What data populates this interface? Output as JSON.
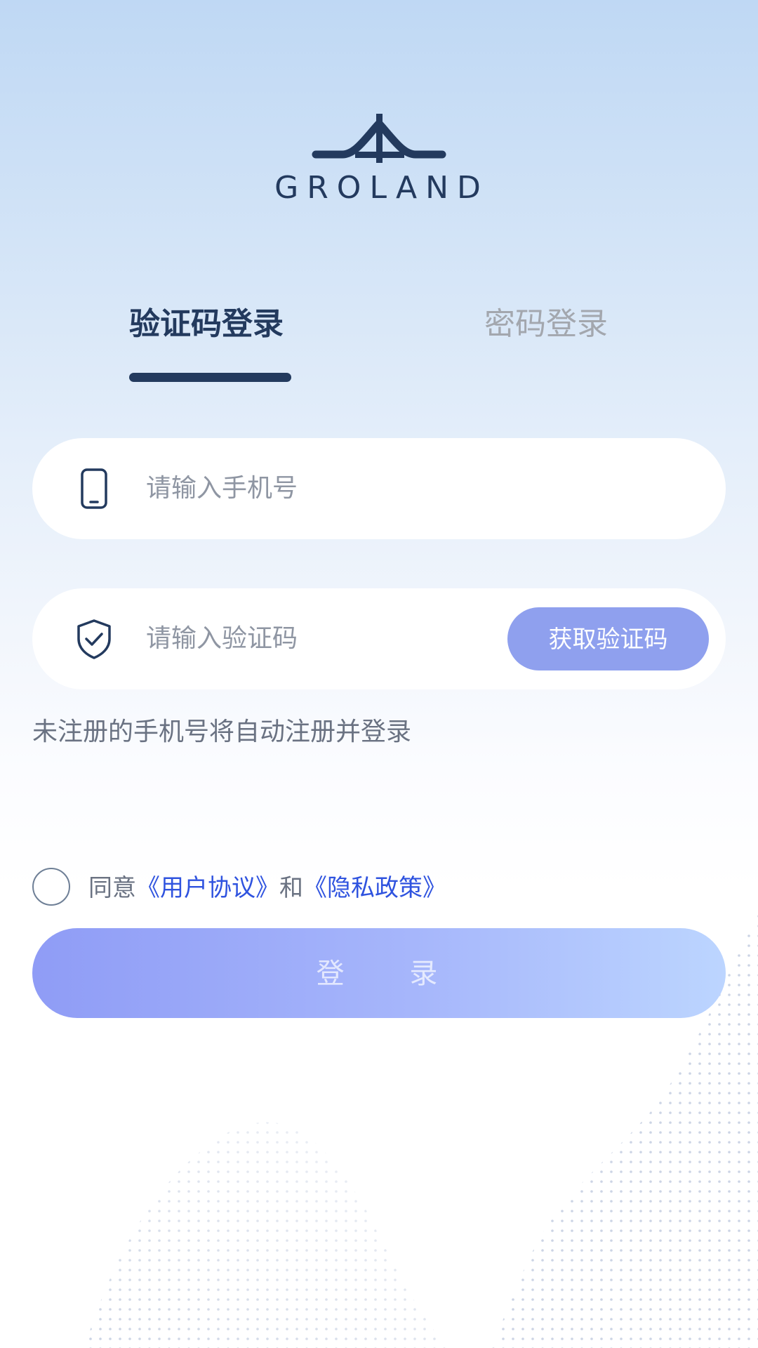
{
  "brand": {
    "name": "GROLAND"
  },
  "tabs": [
    {
      "label": "验证码登录",
      "active": true
    },
    {
      "label": "密码登录",
      "active": false
    }
  ],
  "phone_field": {
    "placeholder": "请输入手机号",
    "icon": "phone-icon"
  },
  "code_field": {
    "placeholder": "请输入验证码",
    "icon": "shield-check-icon",
    "button_label": "获取验证码"
  },
  "hint": "未注册的手机号将自动注册并登录",
  "agreement": {
    "prefix": "同意",
    "user_agreement": "《用户协议》",
    "conjunction": "和",
    "privacy_policy": "《隐私政策》",
    "checked": false
  },
  "login_button": {
    "label": "登 录"
  },
  "colors": {
    "primary_dark": "#233a5e",
    "link_blue": "#2f53df",
    "button_blue": "#8fa0ee",
    "login_gradient_start": "#8f9cf6",
    "login_gradient_end": "#bcd5ff"
  }
}
